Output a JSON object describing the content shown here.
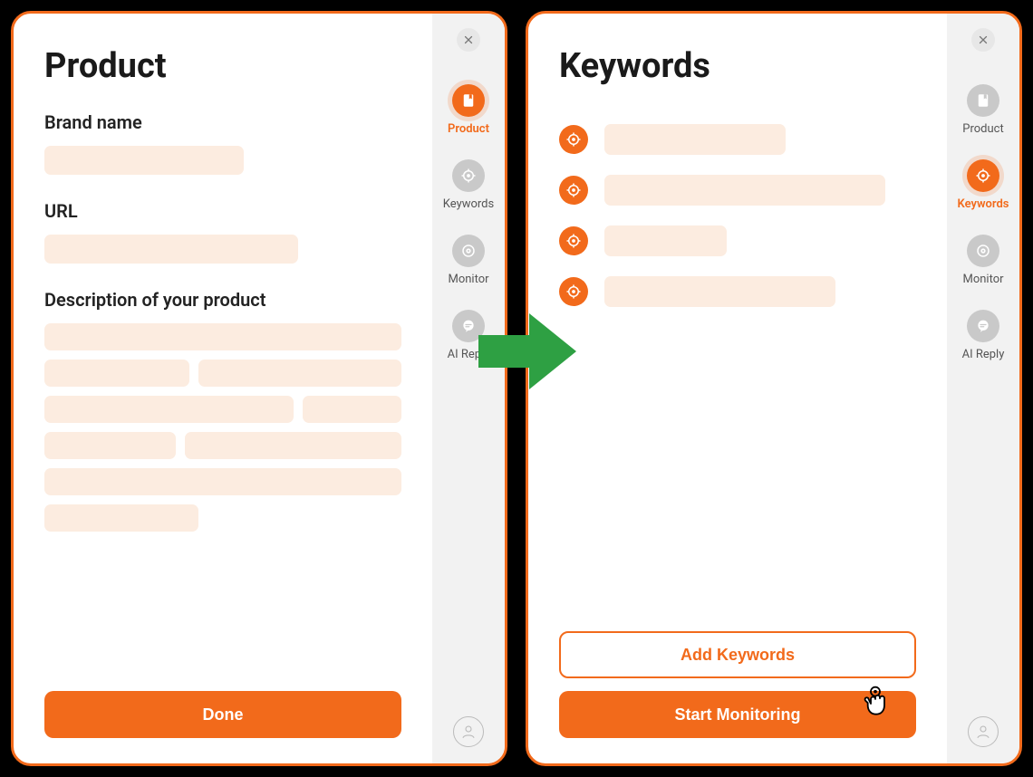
{
  "colors": {
    "accent": "#f26a1b",
    "arrow": "#2ea043",
    "placeholder": "#fcece0"
  },
  "sidebar": {
    "items": [
      {
        "label": "Product",
        "icon": "bookmark"
      },
      {
        "label": "Keywords",
        "icon": "target"
      },
      {
        "label": "Monitor",
        "icon": "eye"
      },
      {
        "label": "AI Reply",
        "icon": "chat"
      }
    ]
  },
  "panel_left": {
    "title": "Product",
    "fields": {
      "brand_label": "Brand name",
      "url_label": "URL",
      "description_label": "Description of your product"
    },
    "done_label": "Done",
    "active_nav_index": 0
  },
  "panel_right": {
    "title": "Keywords",
    "add_label": "Add Keywords",
    "start_label": "Start Monitoring",
    "active_nav_index": 1,
    "keyword_count": 4
  }
}
